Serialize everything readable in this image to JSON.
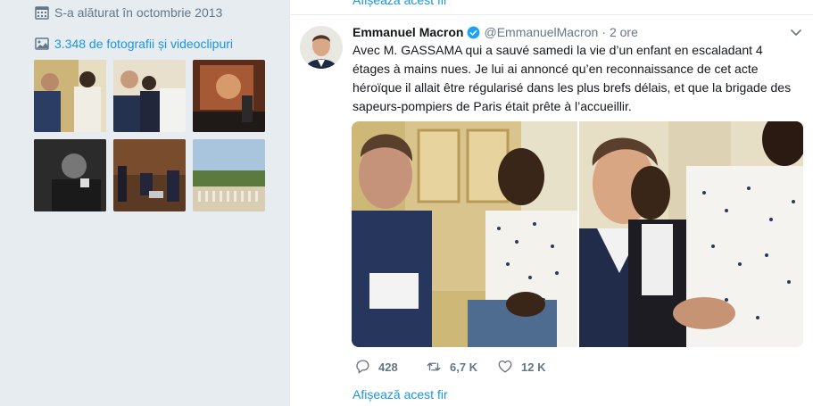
{
  "sidebar": {
    "joined_text": "S-a alăturat în octombrie 2013",
    "photos_link": "3.348 de fotografii și videoclipuri",
    "calendar_icon": "calendar-icon",
    "photo_icon": "image-icon"
  },
  "previous_tweet": {
    "thread_link": "Afișează acest fir"
  },
  "tweet": {
    "author_name": "Emmanuel Macron",
    "handle": "@EmmanuelMacron",
    "separator": "·",
    "time": "2 ore",
    "text": "Avec M. GASSAMA qui a sauvé samedi la vie d’un enfant en escaladant 4 étages à mains nues. Je lui ai annoncé qu’en reconnaissance de cet acte héroïque il allait être régularisé dans les plus brefs délais, et que la brigade des sapeurs-pompiers de Paris était prête à l’accueillir.",
    "replies": "428",
    "retweets": "6,7 K",
    "likes": "12 K",
    "thread_link": "Afișează acest fir"
  },
  "colors": {
    "link": "#1b95e0",
    "muted": "#657786",
    "background": "#e6ecf0"
  }
}
